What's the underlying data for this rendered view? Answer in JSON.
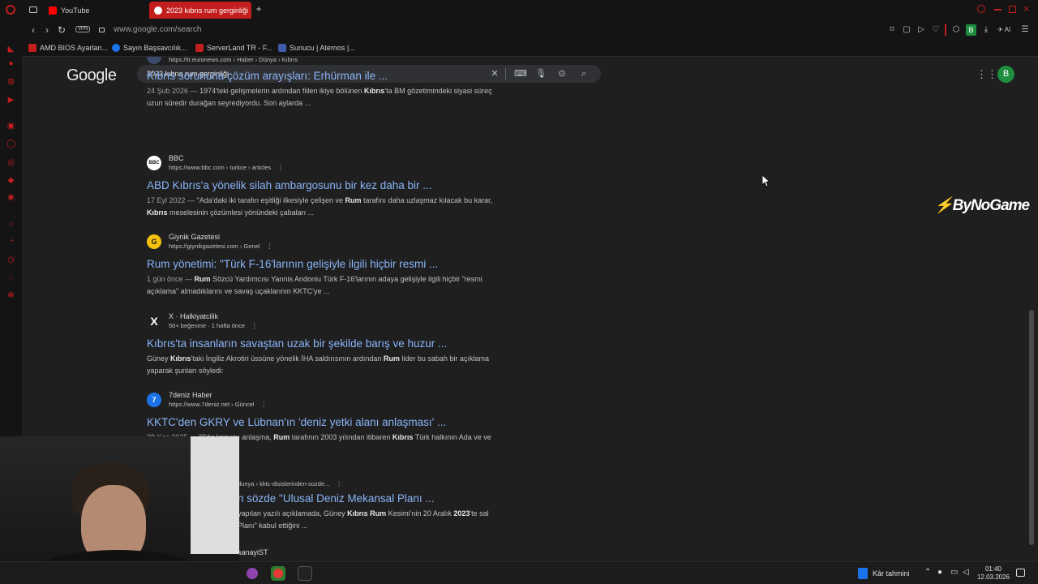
{
  "tabs": [
    {
      "label": "YouTube",
      "active": false
    },
    {
      "label": "2023 kıbrıs rum gerginliği",
      "active": true
    }
  ],
  "address": {
    "url": "www.google.com/search",
    "vpn_label": "VPN"
  },
  "bookmarks": [
    {
      "label": "AMD BIOS Ayarları...",
      "color": "#c41d1d"
    },
    {
      "label": "Sayın Başsavcılık...",
      "color": "#1a73e8"
    },
    {
      "label": "ServerLand TR - F...",
      "color": "#c41d1d"
    },
    {
      "label": "Sunucu | Aternos |...",
      "color": "#3f5ba9"
    }
  ],
  "toolbar": {
    "profile_letter": "B",
    "ai_label": "AI"
  },
  "google": {
    "logo": "Google",
    "query": "2023 kıbrıs rum gerginliği",
    "avatar_letter": "B"
  },
  "results": [
    {
      "site": "",
      "url": "https://tr.euronews.com › Haber › Dünya › Kıbrıs",
      "title": "Kıbrıs sorununa çözüm arayışları: Erhürman ile ...",
      "date": "24 Şub 2026 —",
      "snippet_parts": [
        {
          "t": " 1974'teki gelişmelerin ardından fiilen ikiye bölünen ",
          "b": false
        },
        {
          "t": "Kıbrıs",
          "b": true
        },
        {
          "t": "'ta BM gözetimindeki siyasi süreç uzun süredir durağan seyrediyordu. Son aylarda ...",
          "b": false
        }
      ]
    },
    {
      "site": "BBC",
      "url": "https://www.bbc.com › turkce › articles",
      "fav": "BBC",
      "title": "ABD Kıbrıs'a yönelik silah ambargosunu bir kez daha bir ...",
      "date": "17 Eyl 2022 —",
      "snippet_parts": [
        {
          "t": " \"Ada'daki iki tarafın eşitliği ilkesiyle çelişen ve ",
          "b": false
        },
        {
          "t": "Rum",
          "b": true
        },
        {
          "t": " tarafını daha uzlaşmaz kılacak bu karar, ",
          "b": false
        },
        {
          "t": "Kıbrıs",
          "b": true
        },
        {
          "t": " meselesinin çözümlesi yönündeki çabaları ...",
          "b": false
        }
      ]
    },
    {
      "site": "Giynik Gazetesi",
      "url": "https://giynikgazetesi.com › Genel",
      "fav": "G",
      "title": "Rum yönetimi: \"Türk F-16'larının gelişiyle ilgili hiçbir resmi ...",
      "date": "1 gün önce —",
      "snippet_parts": [
        {
          "t": " ",
          "b": false
        },
        {
          "t": "Rum",
          "b": true
        },
        {
          "t": " Sözcü Yardımcısı Yannis Andoniu Türk F-16'larının adaya gelişiyle ilgili hiçbir \"resmi açıklama\" almadıklarını ve savaş uçaklarının KKTC'ye ...",
          "b": false
        }
      ]
    },
    {
      "site": "X · Halkiyatcilik",
      "url": "50+ beğenme · 1 hafta önce",
      "fav": "X",
      "title": "Kıbrıs'ta insanların savaştan uzak bir şekilde barış ve huzur ...",
      "date": "",
      "snippet_parts": [
        {
          "t": "Güney ",
          "b": false
        },
        {
          "t": "Kıbrıs",
          "b": true
        },
        {
          "t": "'taki İngiliz Akrotiri üssüne yönelik İHA saldırısının ardından ",
          "b": false
        },
        {
          "t": "Rum",
          "b": true
        },
        {
          "t": " lider bu sabah bir açıklama yaparak şunları söyledi:",
          "b": false
        }
      ]
    },
    {
      "site": "7deniz Haber",
      "url": "https://www.7deniz.net › Güncel",
      "fav": "7",
      "title": "KKTC'den GKRY ve Lübnan'ın 'deniz yetki alanı anlaşması' ...",
      "date": "28 Kas 2025 —",
      "snippet_parts": [
        {
          "t": " \"Söz konusu anlaşma, ",
          "b": false
        },
        {
          "t": "Rum",
          "b": true
        },
        {
          "t": " tarafının 2003 yılından itibaren ",
          "b": false
        },
        {
          "t": "Kıbrıs",
          "b": true
        },
        {
          "t": " Türk halkının Ada ve ve çıkarlarını gasp etmeye ...",
          "b": false
        }
      ]
    },
    {
      "site": "",
      "url": "dunya › kktc-disislerinden-sozde...",
      "title": "n sözde \"Ulusal Deniz Mekansal Planı ...",
      "date": "",
      "snippet_parts": [
        {
          "t": "yapılan yazılı açıklamada, Güney ",
          "b": false
        },
        {
          "t": "Kıbrıs Rum",
          "b": true
        },
        {
          "t": " Kesimi'nin 20 Aralık ",
          "b": false
        },
        {
          "t": "2023",
          "b": true
        },
        {
          "t": "'te sal Planı\" kabul ettiğini ...",
          "b": false
        }
      ]
    }
  ],
  "last_site": "sanayiST",
  "watermark": "ByNoGame",
  "taskbar": {
    "weather": "Kâr tahmini",
    "time": "01:40",
    "date": "12.03.2026"
  }
}
